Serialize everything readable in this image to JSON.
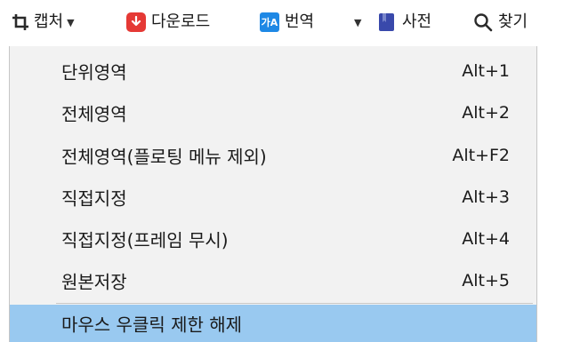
{
  "toolbar": {
    "capture_label": "캡처",
    "download_label": "다운로드",
    "translate_label": "번역",
    "translate_icon_text": "가A",
    "dictionary_label": "사전",
    "search_label": "찾기"
  },
  "menu": {
    "items": [
      {
        "label": "단위영역",
        "shortcut": "Alt+1"
      },
      {
        "label": "전체영역",
        "shortcut": "Alt+2"
      },
      {
        "label": "전체영역(플로팅 메뉴 제외)",
        "shortcut": "Alt+F2"
      },
      {
        "label": "직접지정",
        "shortcut": "Alt+3"
      },
      {
        "label": "직접지정(프레임 무시)",
        "shortcut": "Alt+4"
      },
      {
        "label": "원본저장",
        "shortcut": "Alt+5"
      },
      {
        "label": "마우스 우클릭 제한 해제",
        "shortcut": ""
      }
    ]
  },
  "colors": {
    "download_icon": "#e53935",
    "translate_icon": "#1e88e5",
    "dictionary_icon": "#3949ab",
    "highlight": "#99c9f0",
    "menu_bg": "#f2f2f2"
  }
}
